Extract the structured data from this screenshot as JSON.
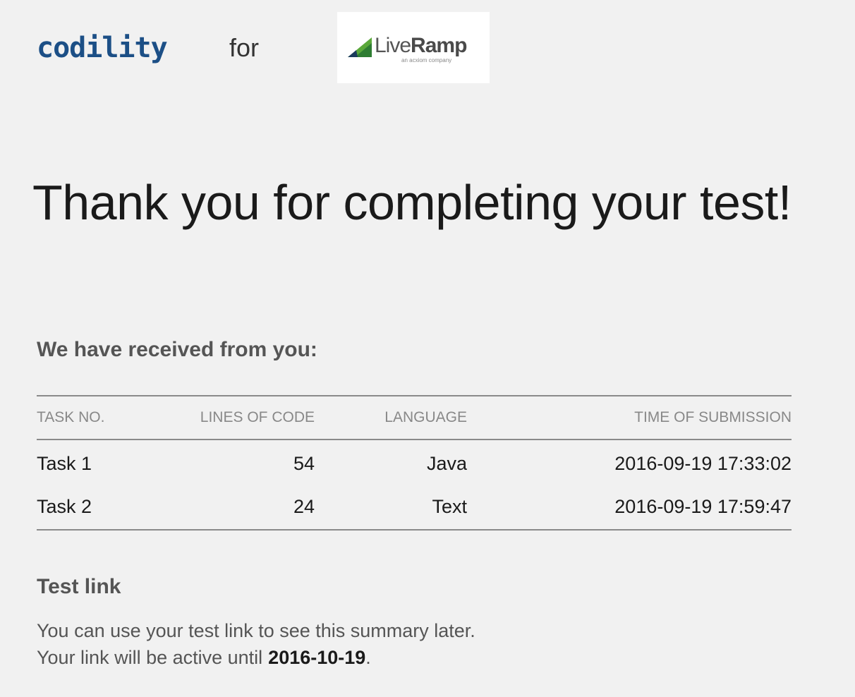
{
  "header": {
    "brand_logo_text": "codility",
    "for_text": "for",
    "partner": {
      "name_light": "Live",
      "name_bold": "Ramp",
      "tagline": "an acxiom company"
    }
  },
  "title": "Thank you for completing your test!",
  "received": {
    "heading": "We have received from you:",
    "columns": {
      "task": "TASK NO.",
      "lines": "LINES OF CODE",
      "language": "LANGUAGE",
      "time": "TIME OF SUBMISSION"
    },
    "rows": [
      {
        "task": "Task 1",
        "lines": "54",
        "language": "Java",
        "time": "2016-09-19 17:33:02"
      },
      {
        "task": "Task 2",
        "lines": "24",
        "language": "Text",
        "time": "2016-09-19 17:59:47"
      }
    ]
  },
  "test_link": {
    "heading": "Test link",
    "line1": "You can use your test link to see this summary later.",
    "line2_prefix": "Your link will be active until",
    "expiry_date": "2016-10-19",
    "line2_suffix": "."
  },
  "colors": {
    "background": "#f1f1f1",
    "brand_dark": "#1c4f86",
    "brand_light": "#2a8fd0",
    "partner_green": "#5aa83a"
  },
  "icons": {
    "partner_mark": "liveramp-triangle-icon"
  }
}
